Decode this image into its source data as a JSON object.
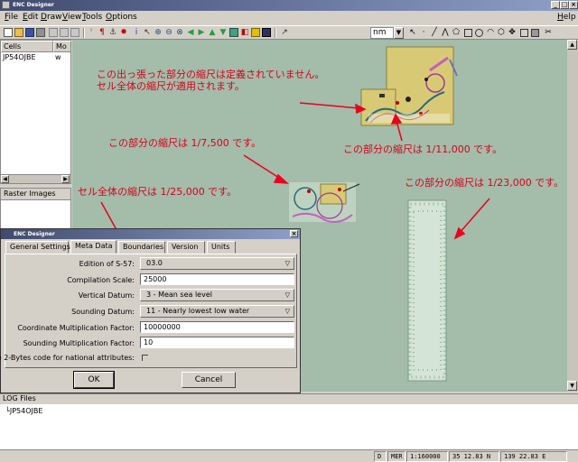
{
  "window": {
    "title": "ENC Designer"
  },
  "menu": [
    "File",
    "Edit",
    "Draw",
    "View",
    "Tools",
    "Options"
  ],
  "help_label": "Help",
  "toolbar": {
    "unit": "nm"
  },
  "cells_panel": {
    "col_cells": "Cells",
    "col_mode": "Mo",
    "row_name": "JP54OJBE",
    "row_mode": "w"
  },
  "raster_panel": {
    "title": "Raster Images"
  },
  "annotations": {
    "a1_line1": "この出っ張った部分の縮尺は定義されていません。",
    "a1_line2": "セル全体の縮尺が適用されます。",
    "a2": "この部分の縮尺は 1/7,500 です。",
    "a3": "この部分の縮尺は 1/11,000 です。",
    "a4": "セル全体の縮尺は 1/25,000 です。",
    "a5": "この部分の縮尺は 1/23,000 です。"
  },
  "dialog": {
    "title": "ENC Designer",
    "tabs": [
      "General Settings",
      "Meta Data",
      "Boundaries",
      "Version",
      "Units"
    ],
    "active_tab": "Meta Data",
    "fields": {
      "edition_label": "Edition of S-57:",
      "edition_value": "03.0",
      "comp_scale_label": "Compilation Scale:",
      "comp_scale_value": "25000",
      "vdatum_label": "Vertical Datum:",
      "vdatum_value": "3 - Mean sea level",
      "sdatum_label": "Sounding Datum:",
      "sdatum_value": "11 - Nearly lowest low water",
      "coord_label": "Coordinate Multiplication Factor:",
      "coord_value": "10000000",
      "sounding_label": "Sounding Multiplication Factor:",
      "sounding_value": "10",
      "twobyte_label": "Use 2-Bytes code for national attributes:"
    },
    "ok_label": "OK",
    "cancel_label": "Cancel"
  },
  "log": {
    "title": "LOG Files",
    "entry": "JP54OJBE"
  },
  "status": {
    "s1": "D",
    "s2": "MER",
    "scale": "1:160000",
    "lat": "35 12.83 N",
    "lon": "139 22.83 E"
  },
  "colors": {
    "map_bg": "#a4bcaa",
    "annotation": "#d8001a",
    "arrow": "#e8001e",
    "land": "#d8ca74"
  }
}
